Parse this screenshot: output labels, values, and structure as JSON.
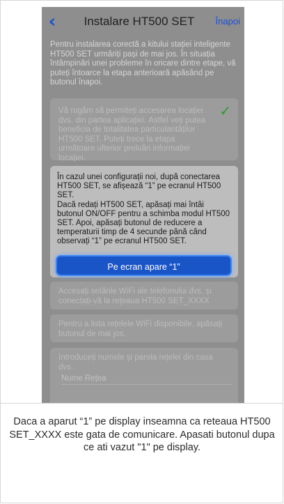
{
  "header": {
    "title": "Instalare HT500 SET",
    "back_label": "Înapoi"
  },
  "intro_text": "Pentru instalarea corectă a kitului stației inteligente HT500 SET urmăriți pași de mai jos. În situația întâmpinări unei probleme în oricare dintre etape, vă puteți întoarce la etapa anterioară apăsând pe butonul înapoi.",
  "steps": [
    {
      "text": "Vă rugăm să permiteți accesarea locației dvs. din partea aplicației. Astfel veți putea beneficia de totalitatea particularităților HT500 SET. Puteți trece la etapa următoare ulterior preluări informației locației.",
      "completed": true
    },
    {
      "text": "În cazul unei configurații noi, după conectarea HT500 SET, se afișează “1” pe ecranul HT500 SET.\nDacă redați HT500 SET, apăsați mai întâi butonul ON/OFF pentru a schimba modul HT500 SET. Apoi, apăsați butonul de reducere a temperaturii timp de 4 secunde până când observați “1” pe ecranul HT500 SET.",
      "button_label": "Pe ecran apare “1”"
    },
    {
      "text": "Accesați setările WiFi ale telefonului dvs. și conectați-vă la rețeaua HT500 SET_XXXX"
    },
    {
      "text": "Pentru a lista rețelele WiFi disponibile, apăsați butonul de mai jos."
    },
    {
      "text": "Introduceți numele și parola rețelei din casa dvs.",
      "field_placeholder": "Nume Rețea"
    }
  ],
  "caption": "Daca a aparut “1” pe display inseamna ca reteaua HT500 SET_XXXX este gata de comunicare. Apasati butonul dupa ce ati vazut \"1\" pe display.",
  "colors": {
    "accent": "#1a55c8",
    "check": "#2c9a2e"
  },
  "icons": {
    "back": "chevron-left-icon",
    "done": "check-icon"
  }
}
